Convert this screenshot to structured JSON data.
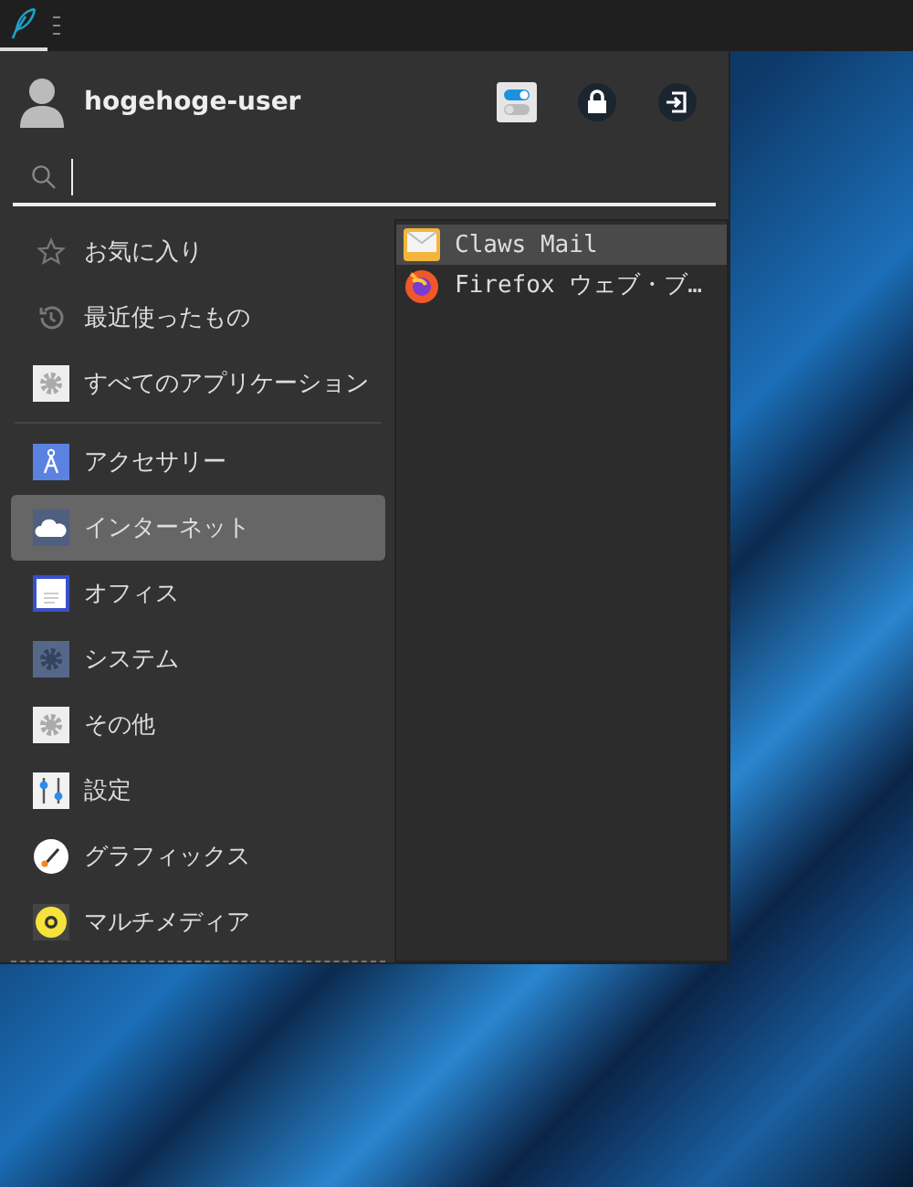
{
  "user": {
    "name": "hogehoge-user"
  },
  "places": [
    {
      "label": "お気に入り",
      "selected": false
    },
    {
      "label": "最近使ったもの",
      "selected": false
    },
    {
      "label": "すべてのアプリケーション",
      "selected": false
    }
  ],
  "categories": [
    {
      "label": "アクセサリー",
      "selected": false
    },
    {
      "label": "インターネット",
      "selected": true
    },
    {
      "label": "オフィス",
      "selected": false
    },
    {
      "label": "システム",
      "selected": false
    },
    {
      "label": "その他",
      "selected": false
    },
    {
      "label": "設定",
      "selected": false
    },
    {
      "label": "グラフィックス",
      "selected": false
    },
    {
      "label": "マルチメディア",
      "selected": false
    }
  ],
  "apps": [
    {
      "label": "Claws Mail",
      "selected": true
    },
    {
      "label": "Firefox ウェブ・ブ…",
      "selected": false
    }
  ]
}
